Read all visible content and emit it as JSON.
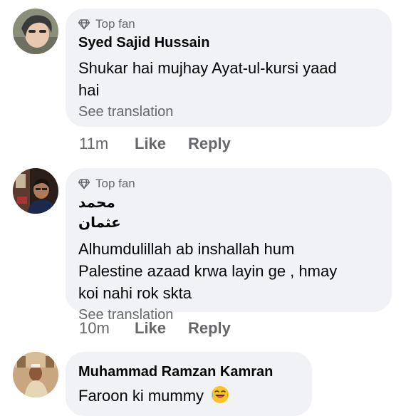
{
  "comments": [
    {
      "badge": "Top fan",
      "author": "Syed Sajid Hussain",
      "text_lines": [
        "Shukar hai mujhay Ayat-ul-kursi yaad",
        "hai"
      ],
      "see_translation": "See translation",
      "time": "11m",
      "like": "Like",
      "reply": "Reply"
    },
    {
      "badge": "Top fan",
      "author": "محمد عثمان",
      "text_lines": [
        "Alhumdulillah ab inshallah hum",
        "Palestine azaad krwa layin ge , hmay",
        "koi nahi rok skta"
      ],
      "see_translation": "See translation",
      "time": "10m",
      "like": "Like",
      "reply": "Reply"
    },
    {
      "author": "Muhammad Ramzan Kamran",
      "text_lines": [
        "Faroon ki mummy"
      ],
      "emoji": "face-with-tears-of-joy"
    }
  ],
  "colors": {
    "bubble": "#f0f2f5",
    "secondary_text": "#65676b",
    "primary_text": "#050505"
  },
  "icons": [
    "top-fan-diamond-icon",
    "laughing-emoji-icon"
  ]
}
